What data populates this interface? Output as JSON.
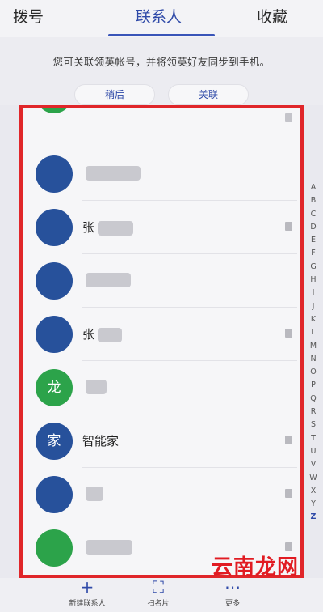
{
  "tabs": {
    "dial": "拨号",
    "contacts": "联系人",
    "favorites": "收藏"
  },
  "banner": {
    "text": "您可关联领英帐号，并将领英好友同步到手机。",
    "later_label": "稍后",
    "link_label": "关联"
  },
  "contacts": [
    {
      "avatar": "",
      "name": "",
      "color": "blue"
    },
    {
      "avatar": "",
      "name": "张",
      "color": "blue"
    },
    {
      "avatar": "",
      "name": "",
      "color": "blue"
    },
    {
      "avatar": "",
      "name": "张",
      "color": "blue"
    },
    {
      "avatar": "龙",
      "name": "",
      "color": "green"
    },
    {
      "avatar": "家",
      "name": "智能家",
      "color": "blue"
    },
    {
      "avatar": "",
      "name": "",
      "color": "blue"
    },
    {
      "avatar": "",
      "name": "",
      "color": "green"
    }
  ],
  "index_letters": [
    "A",
    "B",
    "C",
    "D",
    "E",
    "F",
    "G",
    "H",
    "I",
    "J",
    "K",
    "L",
    "M",
    "N",
    "O",
    "P",
    "Q",
    "R",
    "S",
    "T",
    "U",
    "V",
    "W",
    "X",
    "Y",
    "Z"
  ],
  "toolbar": {
    "add_label": "新建联系人",
    "scan_label": "扫名片",
    "more_label": "更多"
  },
  "watermark": "云南龙网"
}
